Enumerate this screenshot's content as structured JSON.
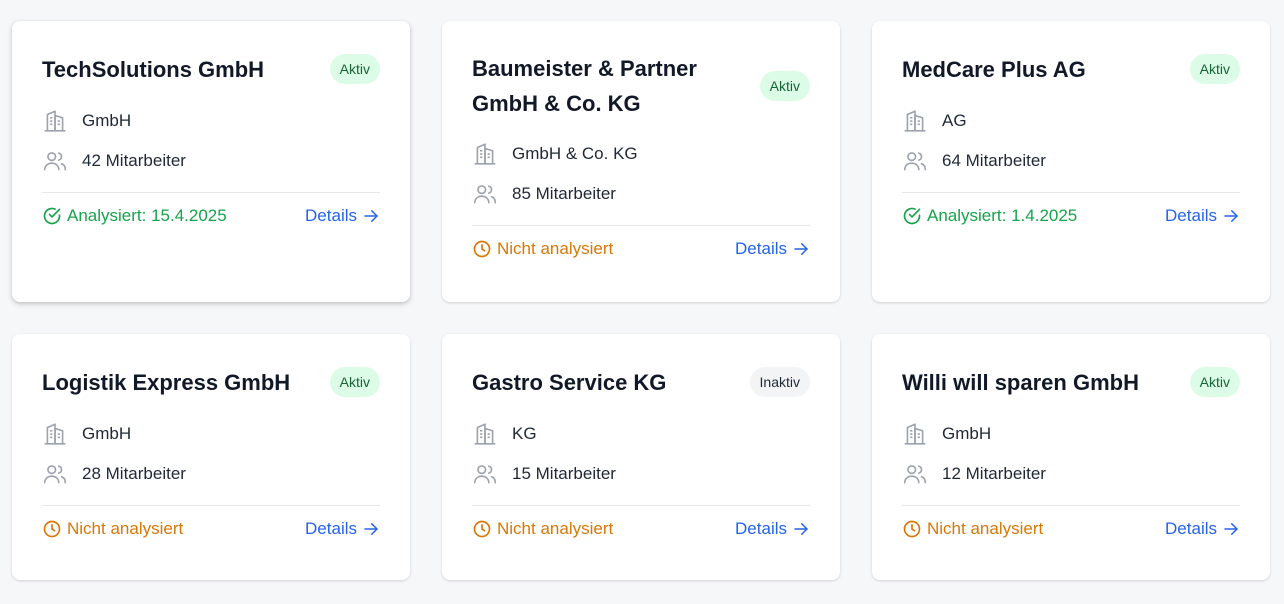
{
  "labels": {
    "details": "Details"
  },
  "colors": {
    "active_badge_bg": "#dcfce7",
    "active_badge_text": "#166534",
    "inactive_badge_bg": "#f3f4f6",
    "analyzed": "#16a34a",
    "not_analyzed": "#d97706",
    "link": "#2563eb"
  },
  "companies": [
    {
      "name": "TechSolutions GmbH",
      "badge": "Aktiv",
      "legal_form": "GmbH",
      "employees": "42 Mitarbeiter",
      "status": "Analysiert: 15.4.2025",
      "status_type": "analyzed"
    },
    {
      "name": "Baumeister & Partner GmbH & Co. KG",
      "badge": "Aktiv",
      "legal_form": "GmbH & Co. KG",
      "employees": "85 Mitarbeiter",
      "status": "Nicht analysiert",
      "status_type": "not_analyzed"
    },
    {
      "name": "MedCare Plus AG",
      "badge": "Aktiv",
      "legal_form": "AG",
      "employees": "64 Mitarbeiter",
      "status": "Analysiert: 1.4.2025",
      "status_type": "analyzed"
    },
    {
      "name": "Logistik Express GmbH",
      "badge": "Aktiv",
      "legal_form": "GmbH",
      "employees": "28 Mitarbeiter",
      "status": "Nicht analysiert",
      "status_type": "not_analyzed"
    },
    {
      "name": "Gastro Service KG",
      "badge": "Inaktiv",
      "legal_form": "KG",
      "employees": "15 Mitarbeiter",
      "status": "Nicht analysiert",
      "status_type": "not_analyzed"
    },
    {
      "name": "Willi will sparen GmbH",
      "badge": "Aktiv",
      "legal_form": "GmbH",
      "employees": "12 Mitarbeiter",
      "status": "Nicht analysiert",
      "status_type": "not_analyzed"
    }
  ],
  "icons": {
    "legal_form": "building-icon",
    "employees": "users-icon",
    "analyzed": "check-circle-icon",
    "not_analyzed": "clock-icon",
    "details": "arrow-right-icon"
  }
}
